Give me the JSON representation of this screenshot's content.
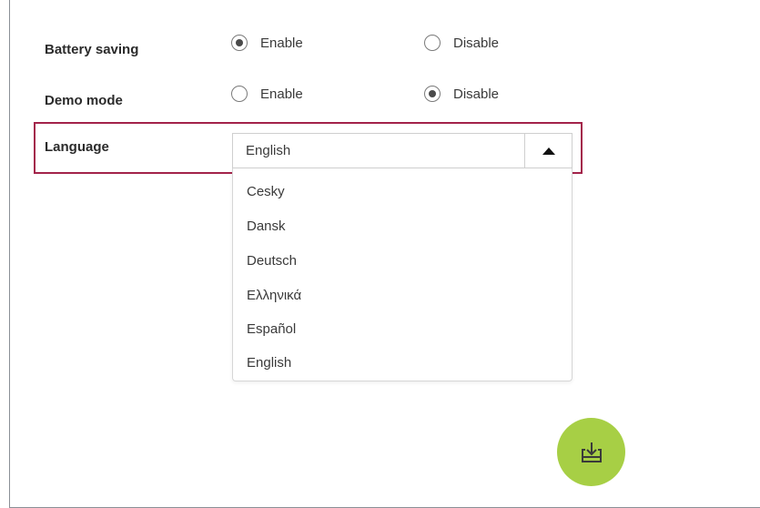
{
  "settings": {
    "battery_saving": {
      "label": "Battery saving",
      "options": [
        "Enable",
        "Disable"
      ],
      "selected": "Enable"
    },
    "demo_mode": {
      "label": "Demo mode",
      "options": [
        "Enable",
        "Disable"
      ],
      "selected": "Disable"
    },
    "language": {
      "label": "Language",
      "selected_value": "English",
      "options": [
        "Cesky",
        "Dansk",
        "Deutsch",
        "Ελληνικά",
        "Español",
        "English"
      ]
    }
  },
  "colors": {
    "highlight_border": "#a3234a",
    "fab_background": "#a7cf45",
    "fab_icon": "#3a3a3a"
  },
  "icons": {
    "dropdown_arrow": "triangle-up-icon",
    "fab": "download-tray-icon"
  }
}
